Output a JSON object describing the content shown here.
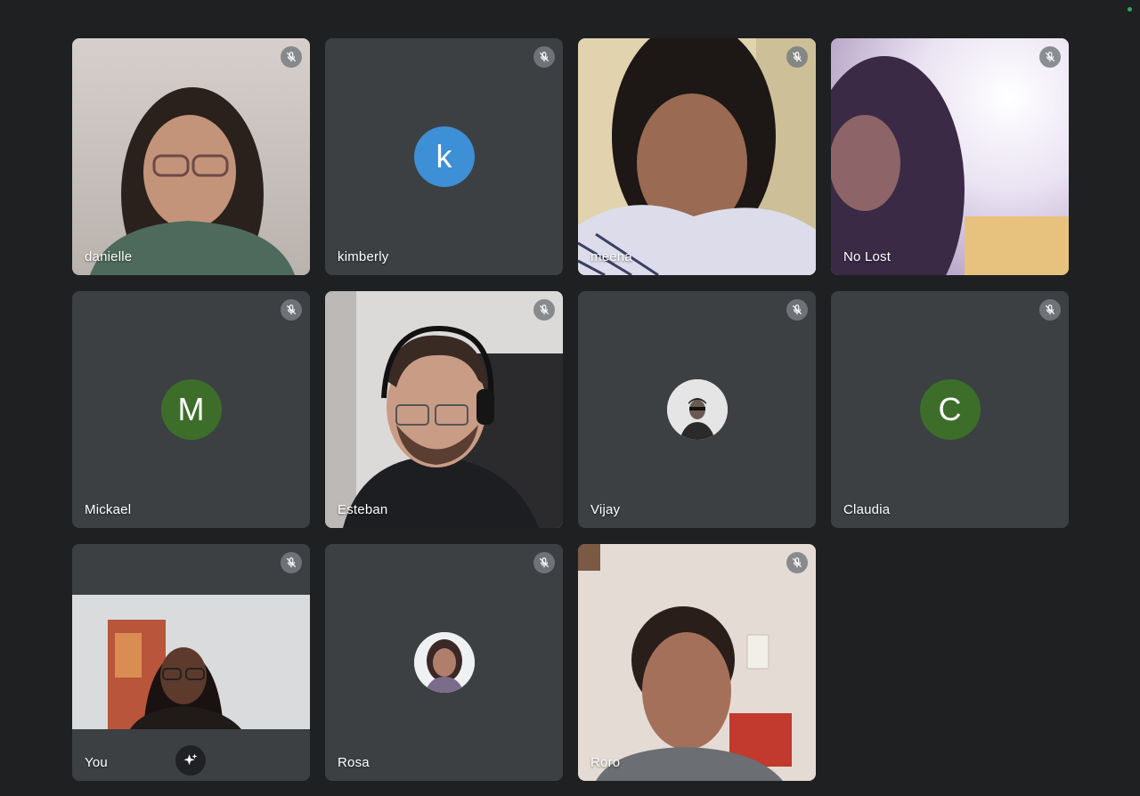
{
  "meeting": {
    "participants": [
      {
        "name": "danielle",
        "type": "video",
        "muted": true
      },
      {
        "name": "kimberly",
        "type": "initial",
        "initial": "k",
        "avatar_color": "#3d8fd6",
        "muted": true
      },
      {
        "name": "meena",
        "type": "video",
        "muted": true
      },
      {
        "name": "No Lost",
        "type": "video",
        "muted": true
      },
      {
        "name": "Mickael",
        "type": "initial",
        "initial": "M",
        "avatar_color": "#3c6e2a",
        "muted": true
      },
      {
        "name": "Esteban",
        "type": "video",
        "muted": true
      },
      {
        "name": "Vijay",
        "type": "photo",
        "muted": true
      },
      {
        "name": "Claudia",
        "type": "initial",
        "initial": "C",
        "avatar_color": "#3c6e2a",
        "muted": true
      },
      {
        "name": "You",
        "type": "self-video",
        "muted": true
      },
      {
        "name": "Rosa",
        "type": "photo",
        "muted": true
      },
      {
        "name": "Roro",
        "type": "video",
        "muted": true
      }
    ]
  },
  "icons": {
    "mute": "microphone-muted-icon",
    "effects": "sparkle-icon"
  },
  "colors": {
    "background": "#1f2022",
    "tile": "#3c4043",
    "status_dot": "#34a853"
  }
}
